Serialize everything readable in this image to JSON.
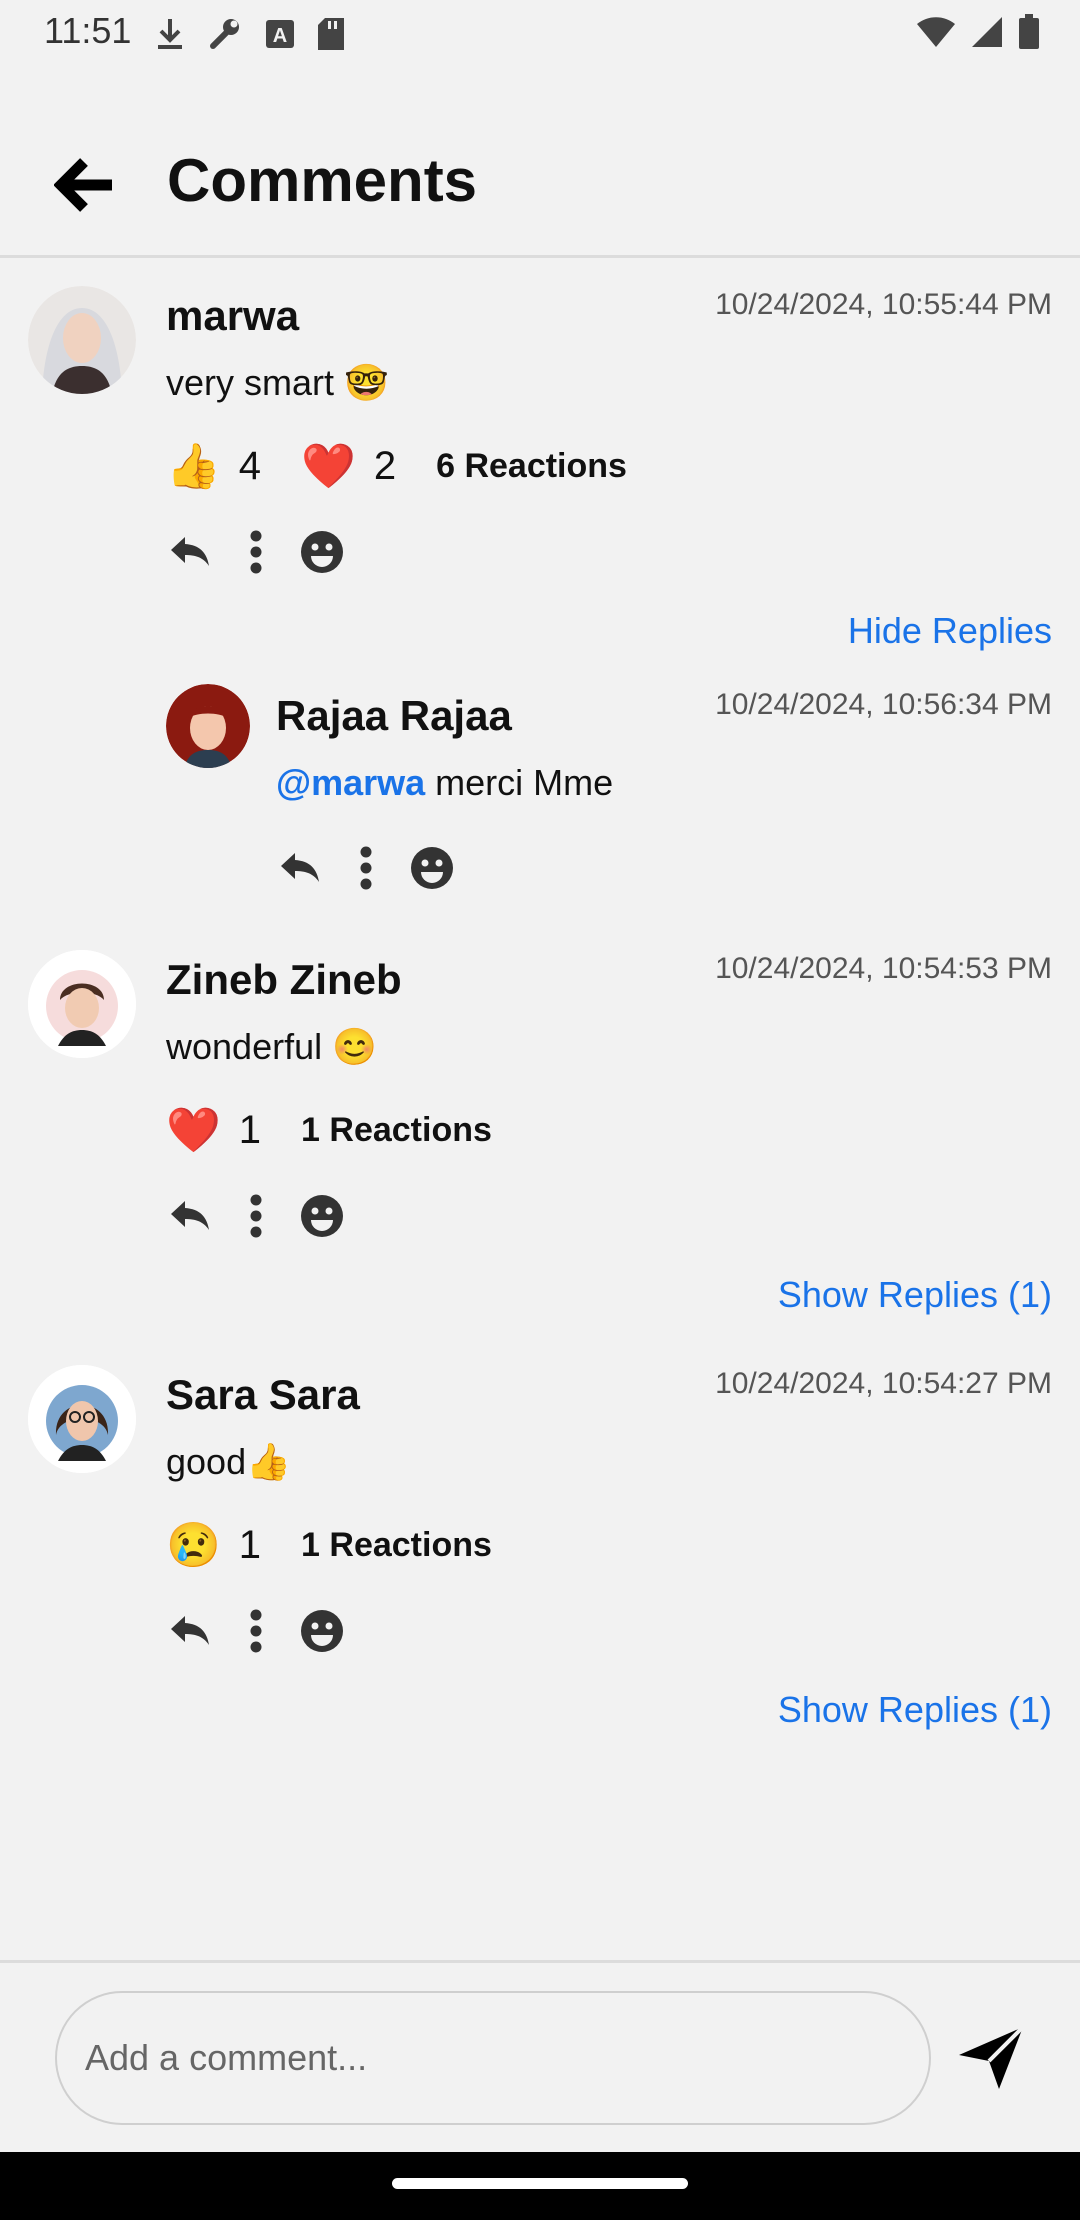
{
  "status_bar": {
    "time": "11:51"
  },
  "header": {
    "title": "Comments"
  },
  "comments": [
    {
      "author": "marwa",
      "timestamp": "10/24/2024, 10:55:44 PM",
      "text": "very smart 🤓",
      "reactions": [
        {
          "emoji": "👍",
          "count": "4"
        },
        {
          "emoji": "❤️",
          "count": "2"
        }
      ],
      "reactions_total": "6 Reactions",
      "replies_toggle": "Hide Replies",
      "replies": [
        {
          "author": "Rajaa Rajaa",
          "timestamp": "10/24/2024, 10:56:34 PM",
          "mention": "@marwa",
          "text": " merci Mme"
        }
      ]
    },
    {
      "author": "Zineb Zineb",
      "timestamp": "10/24/2024, 10:54:53 PM",
      "text": "wonderful 😊",
      "reactions": [
        {
          "emoji": "❤️",
          "count": "1"
        }
      ],
      "reactions_total": "1 Reactions",
      "replies_toggle": "Show Replies (1)"
    },
    {
      "author": "Sara Sara",
      "timestamp": "10/24/2024, 10:54:27 PM",
      "text": "good👍",
      "reactions": [
        {
          "emoji": "😢",
          "count": "1"
        }
      ],
      "reactions_total": "1 Reactions",
      "replies_toggle": "Show Replies (1)"
    }
  ],
  "composer": {
    "placeholder": "Add a comment..."
  },
  "icons": {
    "status_left": [
      "download-icon",
      "wrench-icon",
      "font-icon",
      "sd-card-icon"
    ],
    "status_right": [
      "wifi-icon",
      "signal-icon",
      "battery-icon"
    ],
    "back": "arrow-left-icon",
    "reply": "reply-icon",
    "more": "more-vertical-icon",
    "react": "smiley-icon",
    "send": "send-icon"
  },
  "colors": {
    "link": "#1a73e8",
    "background": "#f2f2f2"
  }
}
